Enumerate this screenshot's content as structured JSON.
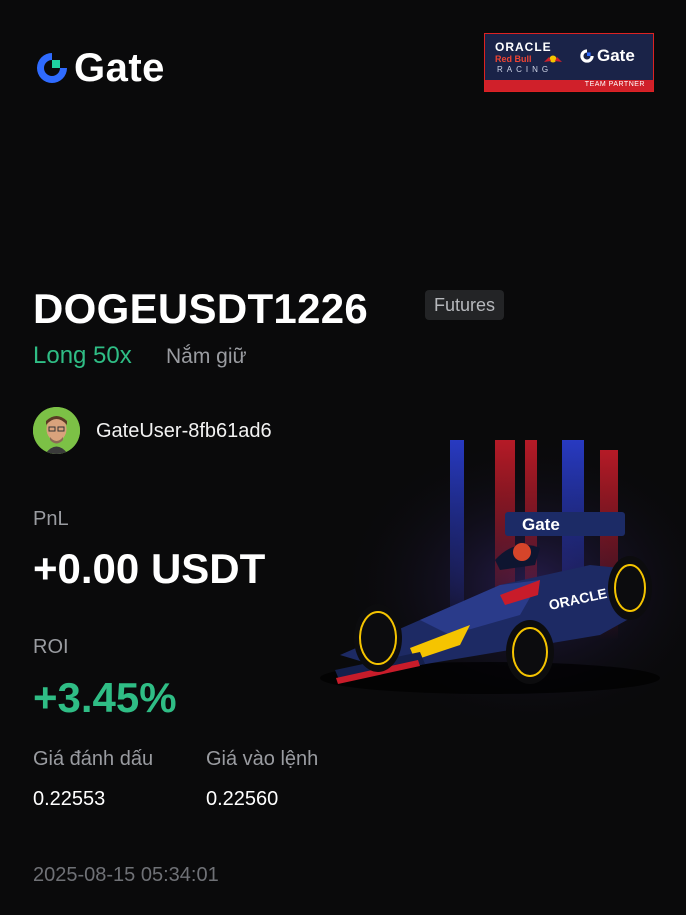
{
  "brand": {
    "logo_text": "Gate",
    "accent_color": "#2f6bff"
  },
  "partner_badge": {
    "oracle_text": "ORACLE",
    "redbull_text": "Red Bull",
    "racing_text": "RACING",
    "gate_text": "Gate",
    "strip_text": "TEAM PARTNER"
  },
  "position": {
    "symbol": "DOGEUSDT1226",
    "tag": "Futures",
    "direction": "Long 50x",
    "status": "Nắm giữ",
    "direction_color": "#2fbd85"
  },
  "user": {
    "name": "GateUser-8fb61ad6",
    "avatar_icon": "user-avatar"
  },
  "stats": {
    "pnl_label": "PnL",
    "pnl_value": "+0.00 USDT",
    "roi_label": "ROI",
    "roi_value": "+3.45%",
    "mark_price_label": "Giá đánh dấu",
    "mark_price_value": "0.22553",
    "entry_price_label": "Giá vào lệnh",
    "entry_price_value": "0.22560"
  },
  "timestamp": "2025-08-15 05:34:01",
  "car_livery_text": "Gate",
  "car_sponsor_text": "ORACLE"
}
